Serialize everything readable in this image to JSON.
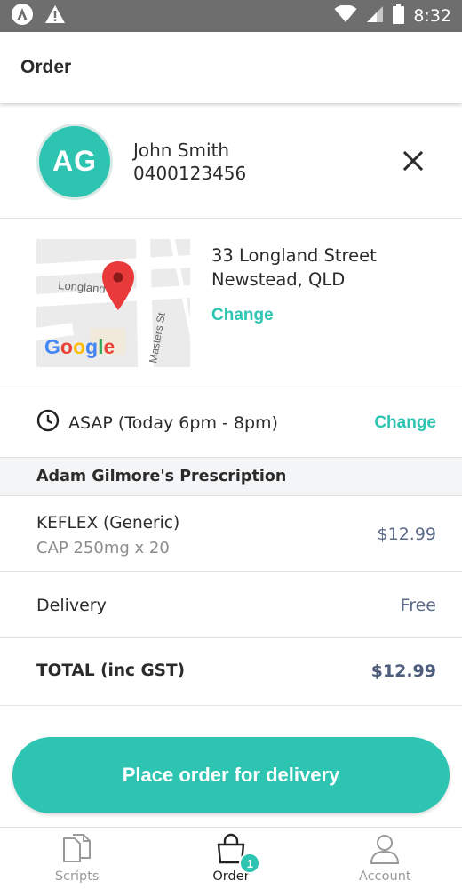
{
  "status_bar": {
    "time": "8:32"
  },
  "app_bar": {
    "title": "Order"
  },
  "customer": {
    "initials": "AG",
    "name": "John Smith",
    "phone": "0400123456"
  },
  "address": {
    "line1": "33 Longland Street",
    "line2": "Newstead, QLD",
    "change_label": "Change",
    "map": {
      "street_label_1": "Longland",
      "street_label_2": "Masters St",
      "brand": "Google"
    }
  },
  "delivery_time": {
    "text": "ASAP (Today 6pm - 8pm)",
    "change_label": "Change"
  },
  "prescription": {
    "header": "Adam Gilmore's Prescription",
    "item_name": "KEFLEX (Generic)",
    "item_detail": "CAP 250mg x 20",
    "item_price": "$12.99"
  },
  "delivery": {
    "label": "Delivery",
    "price": "Free"
  },
  "total": {
    "label": "TOTAL (inc GST)",
    "price": "$12.99"
  },
  "cta": {
    "label": "Place order for delivery"
  },
  "nav": {
    "items": [
      {
        "label": "Scripts"
      },
      {
        "label": "Order",
        "badge": "1"
      },
      {
        "label": "Account"
      }
    ]
  },
  "colors": {
    "accent": "#2ec4b2",
    "price": "#5a6a88",
    "status_bar": "#6e6e6e"
  }
}
